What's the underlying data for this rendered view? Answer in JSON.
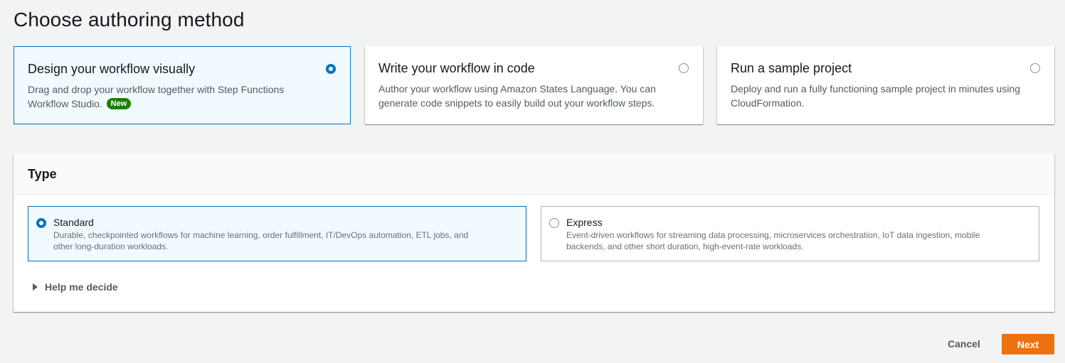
{
  "page": {
    "title": "Choose authoring method"
  },
  "methods": [
    {
      "title": "Design your workflow visually",
      "description": "Drag and drop your workflow together with Step Functions Workflow Studio.",
      "badge": "New",
      "selected": true
    },
    {
      "title": "Write your workflow in code",
      "description": "Author your workflow using Amazon States Language. You can generate code snippets to easily build out your workflow steps.",
      "selected": false
    },
    {
      "title": "Run a sample project",
      "description": "Deploy and run a fully functioning sample project in minutes using CloudFormation.",
      "selected": false
    }
  ],
  "type": {
    "header": "Type",
    "options": [
      {
        "title": "Standard",
        "description": "Durable, checkpointed workflows for machine learning, order fulfillment, IT/DevOps automation, ETL jobs, and other long-duration workloads.",
        "selected": true
      },
      {
        "title": "Express",
        "description": "Event-driven workflows for streaming data processing, microservices orchestration, IoT data ingestion, mobile backends, and other short duration, high-event-rate workloads.",
        "selected": false
      }
    ],
    "help_label": "Help me decide"
  },
  "footer": {
    "cancel_label": "Cancel",
    "next_label": "Next"
  },
  "colors": {
    "accent": "#0073bb",
    "primary_button": "#ec7211",
    "badge": "#1d8102"
  }
}
